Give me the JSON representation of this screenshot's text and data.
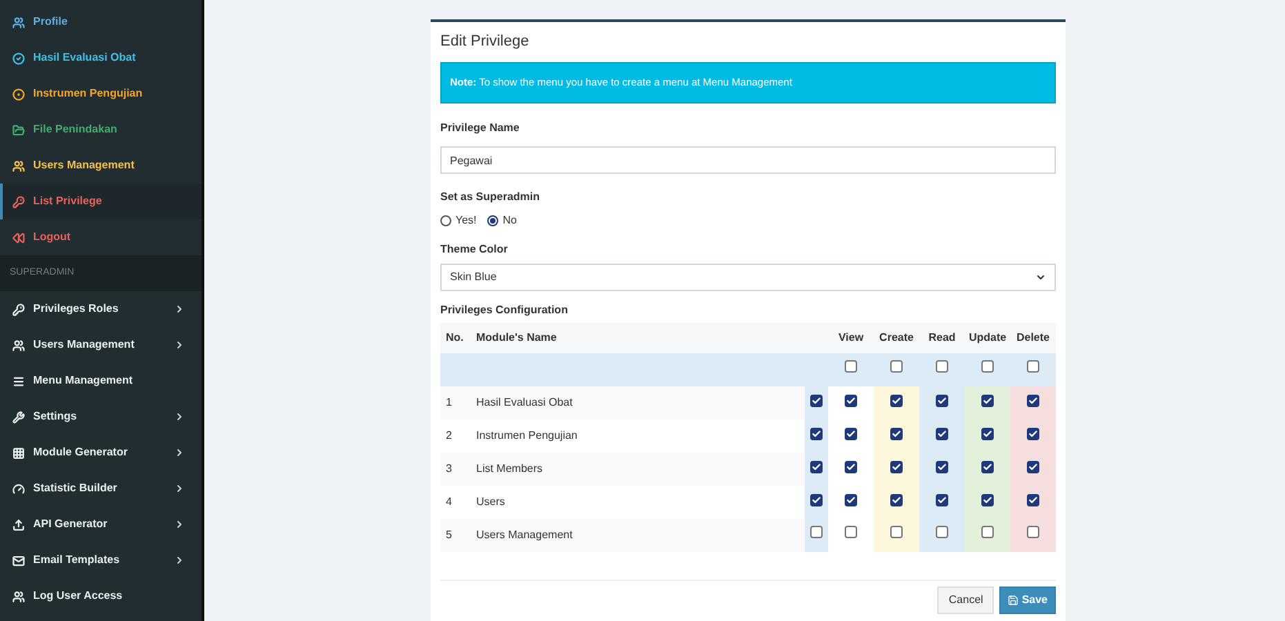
{
  "sidebar": {
    "items": [
      {
        "kind": "link",
        "label": "Profile",
        "color": "#5dade2",
        "arrow": false,
        "selected": false
      },
      {
        "kind": "link",
        "label": "Hasil Evaluasi Obat",
        "color": "#3fc1e6",
        "arrow": false,
        "selected": false
      },
      {
        "kind": "link",
        "label": "Instrumen Pengujian",
        "color": "#f5a623",
        "arrow": false,
        "selected": false
      },
      {
        "kind": "link",
        "label": "File Penindakan",
        "color": "#3fae6a",
        "arrow": false,
        "selected": false
      },
      {
        "kind": "link",
        "label": "Users Management",
        "color": "#f5c04a",
        "arrow": false,
        "selected": false
      },
      {
        "kind": "link",
        "label": "List Privilege",
        "color": "#e8605a",
        "arrow": false,
        "selected": true
      },
      {
        "kind": "link",
        "label": "Logout",
        "color": "#e8605a",
        "arrow": false,
        "selected": false
      },
      {
        "kind": "header",
        "label": "SUPERADMIN"
      },
      {
        "kind": "link",
        "label": "Privileges Roles",
        "color": "#e8eef2",
        "arrow": true,
        "selected": false
      },
      {
        "kind": "link",
        "label": "Users Management",
        "color": "#e8eef2",
        "arrow": true,
        "selected": false
      },
      {
        "kind": "link",
        "label": "Menu Management",
        "color": "#e8eef2",
        "arrow": false,
        "selected": false
      },
      {
        "kind": "link",
        "label": "Settings",
        "color": "#e8eef2",
        "arrow": true,
        "selected": false
      },
      {
        "kind": "link",
        "label": "Module Generator",
        "color": "#e8eef2",
        "arrow": true,
        "selected": false
      },
      {
        "kind": "link",
        "label": "Statistic Builder",
        "color": "#e8eef2",
        "arrow": true,
        "selected": false
      },
      {
        "kind": "link",
        "label": "API Generator",
        "color": "#e8eef2",
        "arrow": true,
        "selected": false
      },
      {
        "kind": "link",
        "label": "Email Templates",
        "color": "#e8eef2",
        "arrow": true,
        "selected": false
      },
      {
        "kind": "link",
        "label": "Log User Access",
        "color": "#e8eef2",
        "arrow": false,
        "selected": false
      }
    ]
  },
  "card": {
    "title": "Edit Privilege",
    "note": "**Note:** To show the menu you have to create a menu at Menu Management",
    "name_label": "Privilege Name",
    "name_value": "Pegawai",
    "superadmin_label": "Set as Superadmin",
    "superadmin_options": [
      {
        "label": "Yes!",
        "selected": false
      },
      {
        "label": "No",
        "selected": true
      }
    ],
    "theme_label": "Theme Color",
    "theme_value": "Skin Blue",
    "config_label": "Privileges Configuration",
    "columns": [
      "No.",
      "Module's Name",
      "View",
      "Create",
      "Read",
      "Update",
      "Delete"
    ],
    "select_all": [
      {
        "checked": false
      },
      {
        "checked": false
      },
      {
        "checked": false
      },
      {
        "checked": false
      },
      {
        "checked": false
      }
    ],
    "rows": [
      {
        "no": "1",
        "module": "Hasil Evaluasi Obat",
        "checks": [
          {
            "checked": true
          },
          {
            "checked": true
          },
          {
            "checked": true
          },
          {
            "checked": true
          },
          {
            "checked": true
          },
          {
            "checked": true
          }
        ]
      },
      {
        "no": "2",
        "module": "Instrumen Pengujian",
        "checks": [
          {
            "checked": true
          },
          {
            "checked": true
          },
          {
            "checked": true
          },
          {
            "checked": true
          },
          {
            "checked": true
          },
          {
            "checked": true
          }
        ]
      },
      {
        "no": "3",
        "module": "List Members",
        "checks": [
          {
            "checked": true
          },
          {
            "checked": true
          },
          {
            "checked": true
          },
          {
            "checked": true
          },
          {
            "checked": true
          },
          {
            "checked": true
          }
        ]
      },
      {
        "no": "4",
        "module": "Users",
        "checks": [
          {
            "checked": true
          },
          {
            "checked": true
          },
          {
            "checked": true
          },
          {
            "checked": true
          },
          {
            "checked": true
          },
          {
            "checked": true
          }
        ]
      },
      {
        "no": "5",
        "module": "Users Management",
        "checks": [
          {
            "checked": false
          },
          {
            "checked": false
          },
          {
            "checked": false
          },
          {
            "checked": false
          },
          {
            "checked": false
          },
          {
            "checked": false
          }
        ]
      }
    ],
    "cancel": "Cancel",
    "save": "Save"
  }
}
